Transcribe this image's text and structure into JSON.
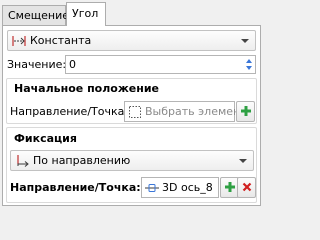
{
  "tabs": [
    {
      "label": "Смещение",
      "active": false
    },
    {
      "label": "Угол",
      "active": true
    }
  ],
  "mode_combo": {
    "value": "Константа",
    "icon": "angle-constant-icon"
  },
  "value_field": {
    "label": "Значение:",
    "value": "0",
    "unit": "°"
  },
  "start_group": {
    "title": "Начальное положение",
    "direction_label": "Направление/Точка:",
    "placeholder": "Выбрать элемент"
  },
  "fix_group": {
    "title": "Фиксация",
    "combo_value": "По направлению",
    "direction_label": "Направление/Точка:",
    "selected_value": "3D ось_8"
  },
  "colors": {
    "accent_blue": "#3a76d8",
    "plus_green": "#2ea043",
    "delete_red": "#d12020"
  }
}
